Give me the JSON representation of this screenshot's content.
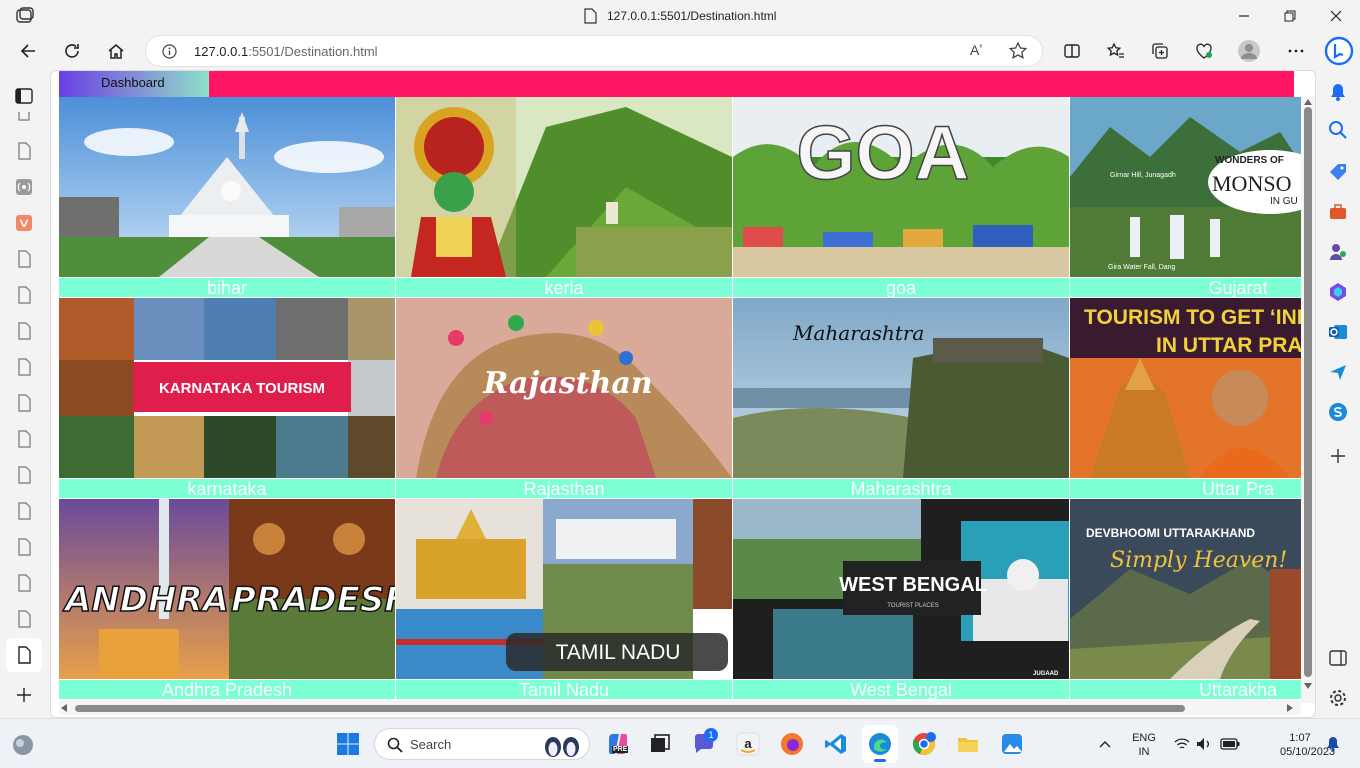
{
  "browser": {
    "window_title": "127.0.0.1:5501/Destination.html",
    "url_host": "127.0.0.1",
    "url_rest": ":5501/Destination.html",
    "read_aloud_label": "Aʼ"
  },
  "page": {
    "dashboard_label": "Dashboard",
    "accent_color": "#ff1466",
    "caption_bg": "#7dffd5",
    "cards": [
      {
        "caption": "bihar"
      },
      {
        "caption": "kerla"
      },
      {
        "caption": "goa",
        "overlay": "GOA"
      },
      {
        "caption": "Gujarat",
        "overlay_line1": "WONDERS OF",
        "overlay_line2": "MONSO",
        "overlay_line3": "IN GU",
        "label_a": "Girnar Hill, Junagadh",
        "label_b": "Gira Water Fall, Dang"
      },
      {
        "caption": "karnataka",
        "overlay": "KARNATAKA TOURISM"
      },
      {
        "caption": "Rajasthan",
        "overlay": "Rajasthan"
      },
      {
        "caption": "Maharashtra",
        "overlay": "Maharashtra"
      },
      {
        "caption": "Uttar Pra",
        "overlay_line1": "TOURISM TO GET ‘INDUSTR",
        "overlay_line2": "IN UTTAR PRADES"
      },
      {
        "caption": "Andhra Pradesh",
        "overlay_a": "ANDHRA",
        "overlay_b": "PRADESH"
      },
      {
        "caption": "Tamil Nadu",
        "overlay": "TAMIL NADU"
      },
      {
        "caption": "West Bengal",
        "overlay": "WEST BENGAL",
        "overlay_sub": "TOURIST PLACES",
        "tag": "JUGAAD"
      },
      {
        "caption": "Uttarakha",
        "overlay_line1": "DEVBHOOMI UTTARAKHAND",
        "overlay_line2": "Simply Heaven!"
      }
    ]
  },
  "taskbar": {
    "search_label": "Search",
    "lang_line1": "ENG",
    "lang_line2": "IN",
    "time": "1:07",
    "date": "05/10/2023",
    "chat_badge": "1",
    "pre_badge": "PRE"
  }
}
